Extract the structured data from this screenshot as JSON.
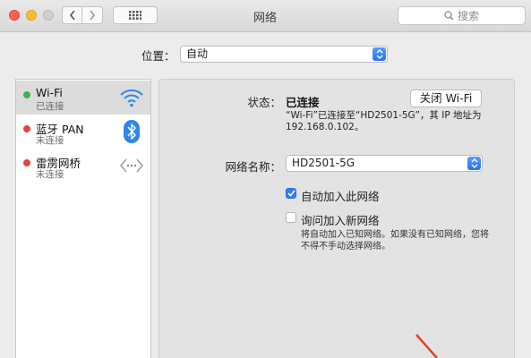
{
  "window": {
    "title": "网络",
    "search_placeholder": "搜索"
  },
  "location": {
    "label": "位置：",
    "value": "自动"
  },
  "services": [
    {
      "name": "Wi-Fi",
      "status": "已连接",
      "status_color": "#3ab54a",
      "icon": "wifi-icon"
    },
    {
      "name": "蓝牙 PAN",
      "status": "未连接",
      "status_color": "#e5433d",
      "icon": "bluetooth-icon"
    },
    {
      "name": "雷雳网桥",
      "status": "未连接",
      "status_color": "#e5433d",
      "icon": "thunderbolt-bridge-icon"
    }
  ],
  "detail": {
    "status_label": "状态：",
    "status_value": "已连接",
    "toggle_button": "关闭 Wi-Fi",
    "status_desc": "“Wi-Fi”已连接至“HD2501-5G”，其 IP 地址为 192.168.0.102。",
    "network_name_label": "网络名称：",
    "network_name_value": "HD2501-5G",
    "auto_join_label": "自动加入此网络",
    "auto_join_checked": true,
    "ask_join_label": "询问加入新网络",
    "ask_join_checked": false,
    "ask_join_hint": "将自动加入已知网络。如果没有已知网络，您将不得不手动选择网络。"
  },
  "colors": {
    "accent": "#2f7ef3",
    "annotation_arrow": "#e8401c"
  }
}
